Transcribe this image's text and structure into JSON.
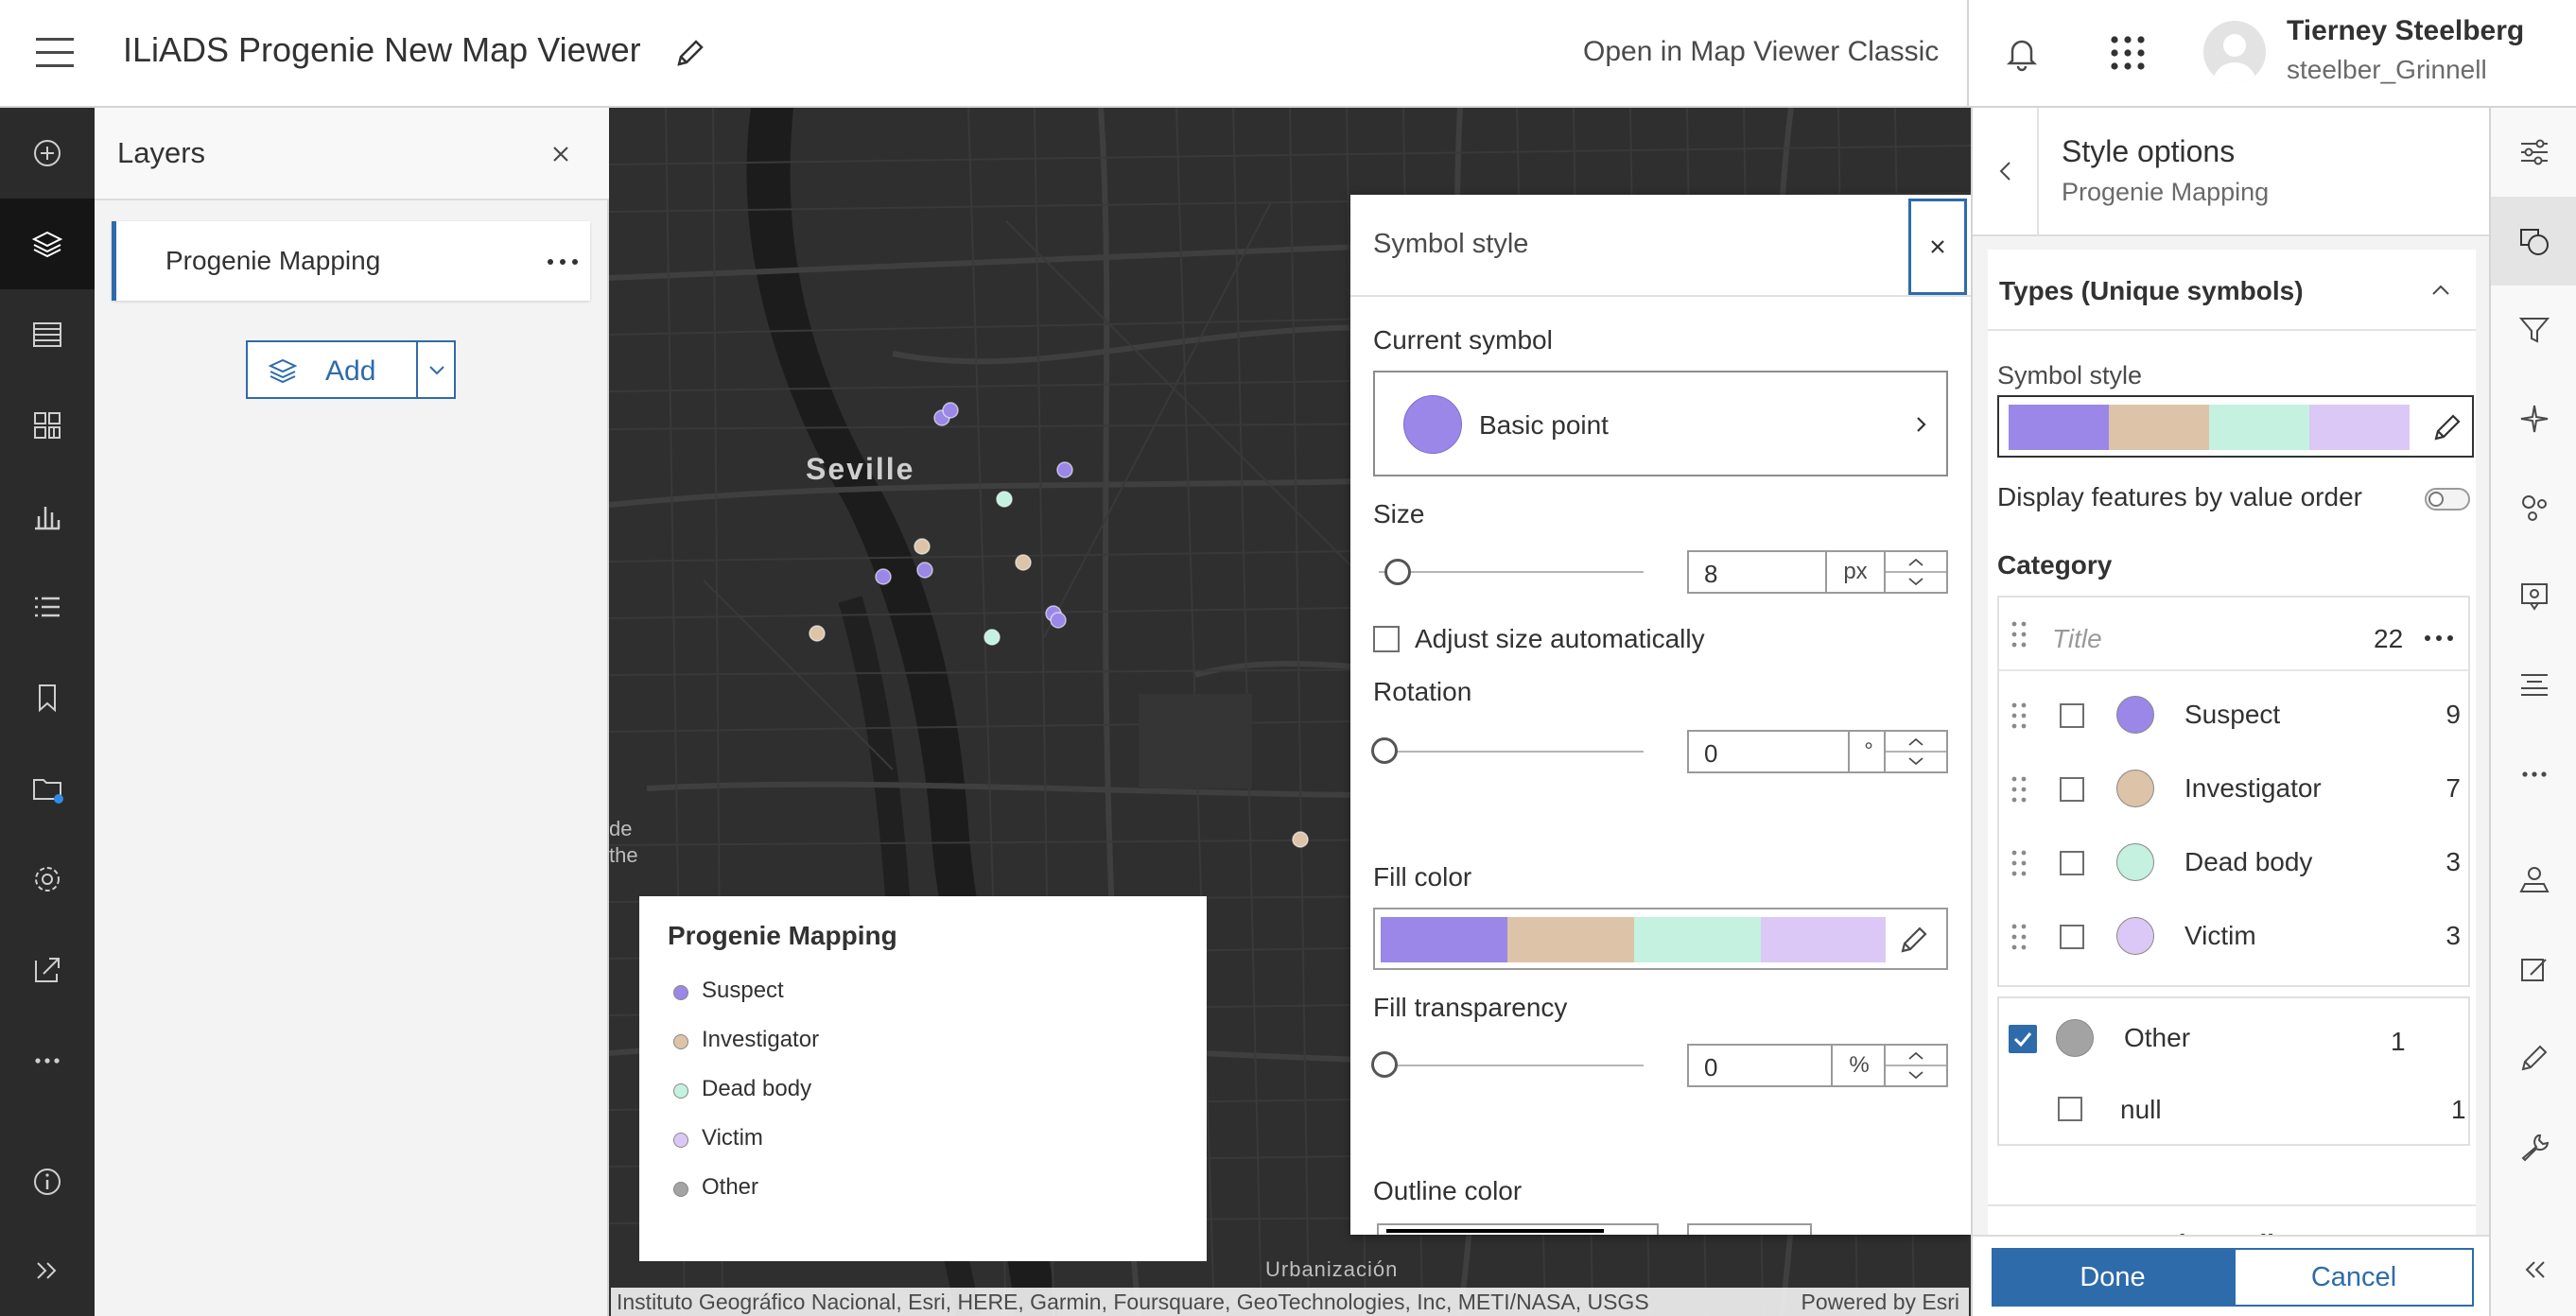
{
  "header": {
    "app_title": "ILiADS Progenie New Map Viewer",
    "classic_link": "Open in Map Viewer Classic",
    "user_name": "Tierney Steelberg",
    "user_id": "steelber_Grinnell"
  },
  "left_toolbar": {
    "items": [
      "add-icon",
      "layers-icon",
      "table-icon",
      "qr-icon",
      "chart-icon",
      "legend-icon",
      "bookmark-icon",
      "folder-icon",
      "settings-icon",
      "share-icon",
      "more-icon",
      "info-icon",
      "expand-icon"
    ],
    "active": "layers-icon"
  },
  "layers_panel": {
    "title": "Layers",
    "layer_name": "Progenie Mapping",
    "add_label": "Add"
  },
  "map": {
    "city_label": "Seville",
    "fragment_1": "de",
    "fragment_2": "the",
    "fragment_3": "Urbanización",
    "attribution": "Instituto Geográfico Nacional, Esri, HERE, Garmin, Foursquare, GeoTechnologies, Inc, METI/NASA, USGS",
    "powered_by": "Powered by Esri"
  },
  "legend": {
    "title": "Progenie Mapping",
    "items": [
      {
        "label": "Suspect",
        "color": "#9b87e8"
      },
      {
        "label": "Investigator",
        "color": "#ddc3a8"
      },
      {
        "label": "Dead body",
        "color": "#c4f1e0"
      },
      {
        "label": "Victim",
        "color": "#dcc8f6"
      },
      {
        "label": "Other",
        "color": "#a3a3a3"
      }
    ]
  },
  "symbol_style": {
    "title": "Symbol style",
    "current_symbol_label": "Current symbol",
    "current_symbol_name": "Basic point",
    "current_symbol_color": "#9b87e8",
    "size_label": "Size",
    "size_value": "8",
    "size_unit": "px",
    "adjust_size_label": "Adjust size automatically",
    "rotation_label": "Rotation",
    "rotation_value": "0",
    "rotation_unit": "°",
    "fill_color_label": "Fill color",
    "fill_transparency_label": "Fill transparency",
    "fill_transparency_value": "0",
    "fill_transparency_unit": "%",
    "outline_color_label": "Outline color",
    "ramp_colors": [
      "#9b87e8",
      "#ddc3a8",
      "#c4f1e0",
      "#dcc8f6"
    ]
  },
  "style_options": {
    "title": "Style options",
    "subtitle": "Progenie Mapping",
    "types_title": "Types (Unique symbols)",
    "symbol_style_label": "Symbol style",
    "display_order_label": "Display features by value order",
    "display_order_on": false,
    "category_label": "Category",
    "title_placeholder": "Title",
    "total_count": "22",
    "categories": [
      {
        "label": "Suspect",
        "count": "9",
        "color": "#9b87e8",
        "checked": false
      },
      {
        "label": "Investigator",
        "count": "7",
        "color": "#ddc3a8",
        "checked": false
      },
      {
        "label": "Dead body",
        "count": "3",
        "color": "#c4f1e0",
        "checked": false
      },
      {
        "label": "Victim",
        "count": "3",
        "color": "#dcc8f6",
        "checked": false
      }
    ],
    "other": {
      "label": "Other",
      "count": "1",
      "color": "#a3a3a3",
      "checked": true
    },
    "null_item": {
      "label": "null",
      "count": "1",
      "checked": false
    },
    "transparency_label": "Transparency by attribute",
    "done_label": "Done",
    "cancel_label": "Cancel"
  },
  "right_toolbar": {
    "items": [
      "properties-icon",
      "styles-icon",
      "filter-icon",
      "effects-icon",
      "clustering-icon",
      "popups-icon",
      "labels-icon",
      "more-icon",
      "field-maps-icon",
      "sketch-icon",
      "pencil-icon",
      "wrench-icon",
      "collapse-icon"
    ],
    "active": "styles-icon"
  },
  "colors": {
    "accent": "#2e6bab",
    "map_bg": "#2e2e2e",
    "toolbar_dark": "#2b2b2b"
  }
}
